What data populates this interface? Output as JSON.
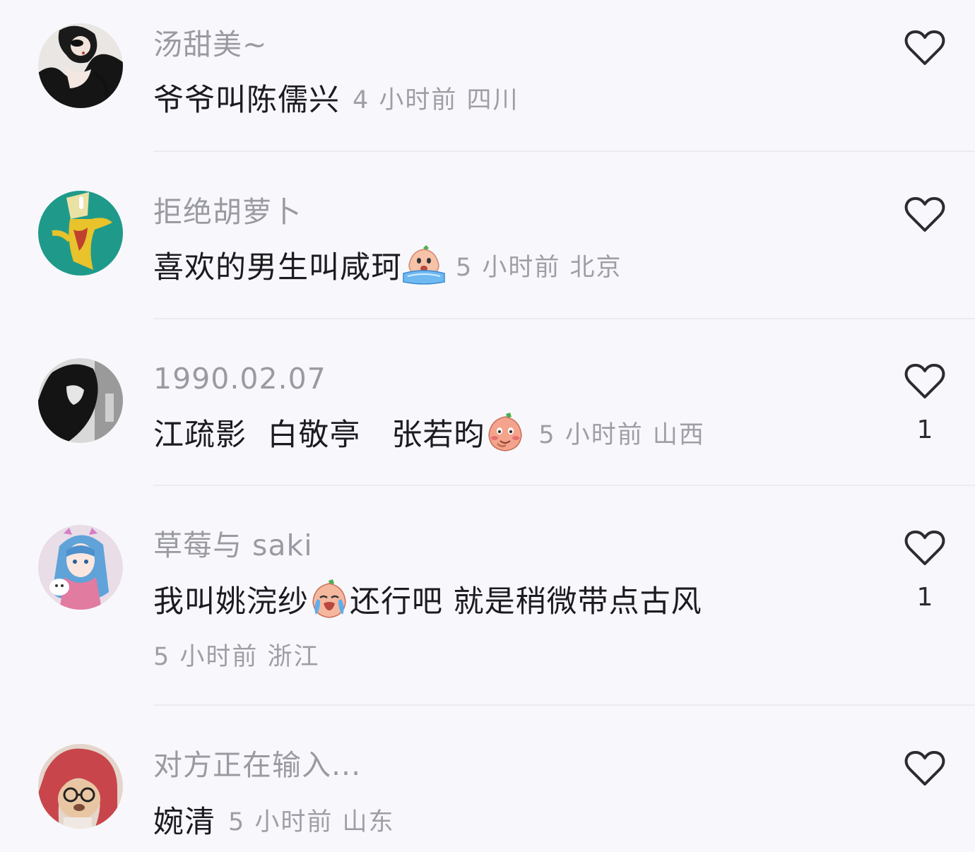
{
  "comments": [
    {
      "username": "汤甜美~",
      "segments": [
        "爷爷叫陈儒兴"
      ],
      "meta": "4 小时前  四川",
      "likes": ""
    },
    {
      "username": "拒绝胡萝卜",
      "segments": [
        "喜欢的男生叫咸珂"
      ],
      "meta": "5 小时前  北京",
      "likes": ""
    },
    {
      "username": "1990.02.07",
      "segments": [
        "江疏影  白敬亭   张若昀"
      ],
      "meta": "5 小时前  山西",
      "likes": "1"
    },
    {
      "username": "草莓与 saki",
      "segments": [
        "我叫姚浣纱",
        "还行吧 就是稍微带点古风"
      ],
      "meta": "5 小时前  浙江",
      "likes": "1"
    },
    {
      "username": "对方正在输入...",
      "segments": [
        "婉清"
      ],
      "meta": "5 小时前  山东",
      "likes": ""
    }
  ],
  "icons": {
    "like": "heart-outline-icon",
    "emoji_crying": "crying-peach-emoji-icon",
    "emoji_shy": "shy-peach-emoji-icon",
    "emoji_sob": "sobbing-peach-emoji-icon"
  },
  "colors": {
    "background": "#f8f8fc",
    "username": "#9a9aa2",
    "text": "#1c1c20",
    "meta": "#9e9ea6",
    "divider": "#ececf0",
    "heart": "#2b2b30"
  }
}
